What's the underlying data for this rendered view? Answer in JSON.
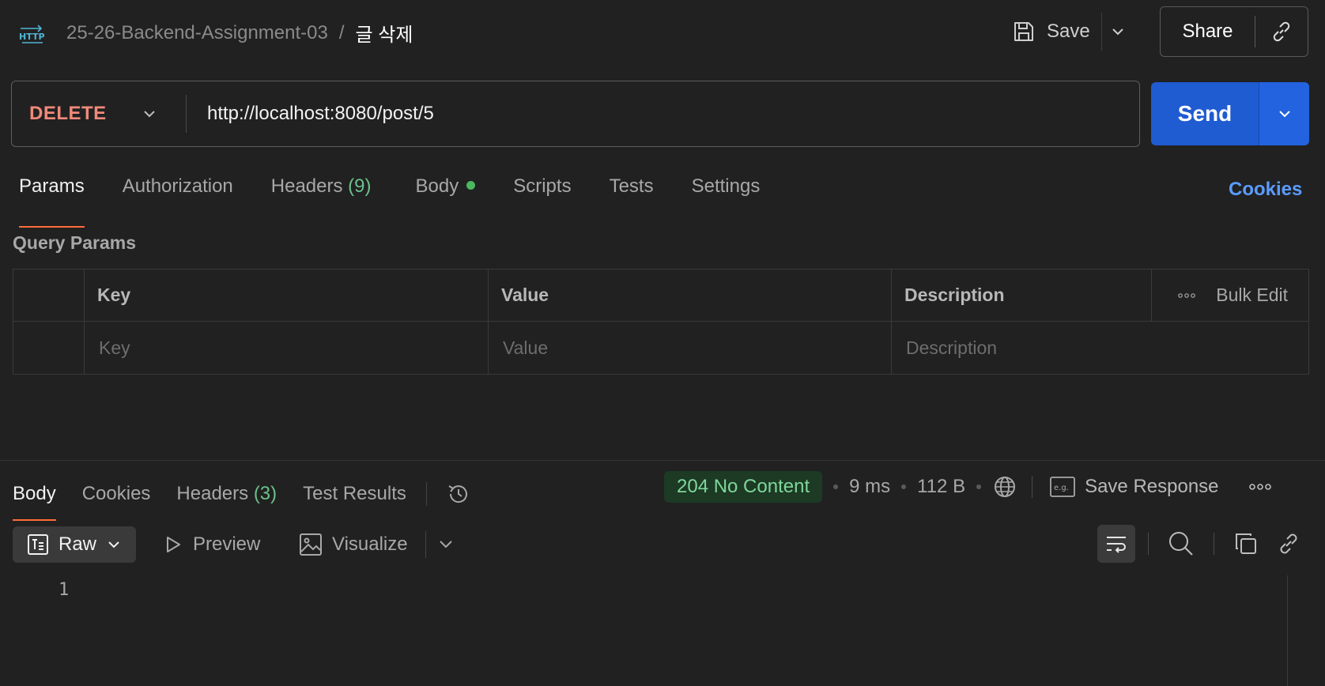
{
  "header": {
    "collection": "25-26-Backend-Assignment-03",
    "separator": "/",
    "request_name": "글 삭제",
    "save_label": "Save",
    "share_label": "Share",
    "icons": {
      "request": "http-icon",
      "save": "save-icon",
      "save_menu": "chevron-down-icon",
      "link": "link-icon"
    }
  },
  "request": {
    "method": "DELETE",
    "method_color": "#f0897a",
    "url": "http://localhost:8080/post/5",
    "send_label": "Send",
    "send_color": "#1f5bd1"
  },
  "request_tabs": {
    "params": "Params",
    "authorization": "Authorization",
    "headers": "Headers",
    "headers_count": "(9)",
    "body": "Body",
    "scripts": "Scripts",
    "tests": "Tests",
    "settings": "Settings",
    "active": "Params",
    "cookies": "Cookies"
  },
  "query_params": {
    "title": "Query Params",
    "columns": {
      "key": "Key",
      "value": "Value",
      "description": "Description"
    },
    "bulk_edit": "Bulk Edit",
    "placeholders": {
      "key": "Key",
      "value": "Value",
      "description": "Description"
    }
  },
  "response": {
    "tabs": {
      "body": "Body",
      "cookies": "Cookies",
      "headers": "Headers",
      "headers_count": "(3)",
      "test_results": "Test Results",
      "active": "Body"
    },
    "status": "204 No Content",
    "status_color": "#7fd79b",
    "time": "9 ms",
    "size": "112 B",
    "save_response": "Save Response",
    "format": "Raw",
    "preview": "Preview",
    "visualize": "Visualize",
    "line_numbers": [
      "1"
    ]
  },
  "accent": "#ff6c37"
}
